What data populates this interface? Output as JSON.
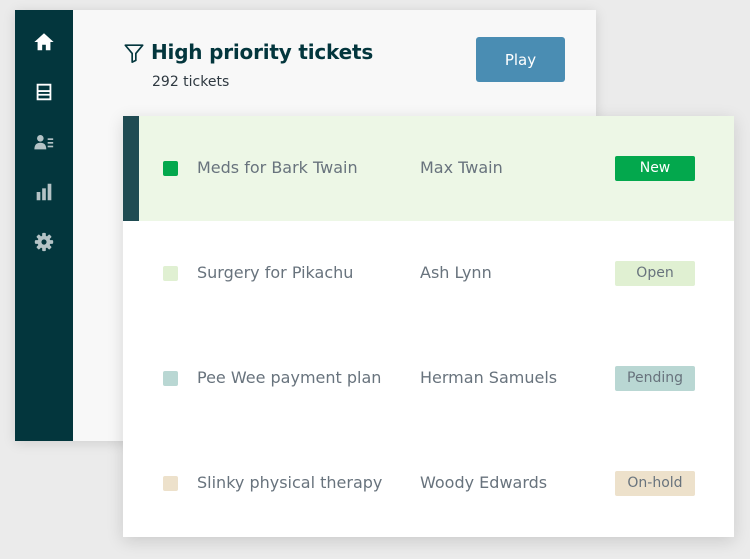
{
  "sidebar": {
    "items": [
      {
        "name": "home-icon",
        "label": "Home"
      },
      {
        "name": "views-icon",
        "label": "Views"
      },
      {
        "name": "customers-icon",
        "label": "Customers"
      },
      {
        "name": "reporting-icon",
        "label": "Reporting"
      },
      {
        "name": "settings-icon",
        "label": "Settings"
      }
    ]
  },
  "view": {
    "filter_icon": "filter-icon",
    "title": "High priority tickets",
    "count_label": "292 tickets",
    "play_label": "Play"
  },
  "tickets": [
    {
      "subject": "Meds for Bark Twain",
      "requester": "Max Twain",
      "status": "New",
      "selected": true
    },
    {
      "subject": "Surgery for Pikachu",
      "requester": "Ash Lynn",
      "status": "Open",
      "selected": false
    },
    {
      "subject": "Pee Wee payment plan",
      "requester": "Herman Samuels",
      "status": "Pending",
      "selected": false
    },
    {
      "subject": "Slinky physical therapy",
      "requester": "Woody Edwards",
      "status": "On-hold",
      "selected": false
    }
  ],
  "colors": {
    "sidebar": "#03363d",
    "play_button": "#4a8db3",
    "selected_row": "#edf7e6",
    "status_new": "#03a84d",
    "status_open": "#e0f0d2",
    "status_pending": "#b9d7d3",
    "status_onhold": "#ede1cb"
  }
}
